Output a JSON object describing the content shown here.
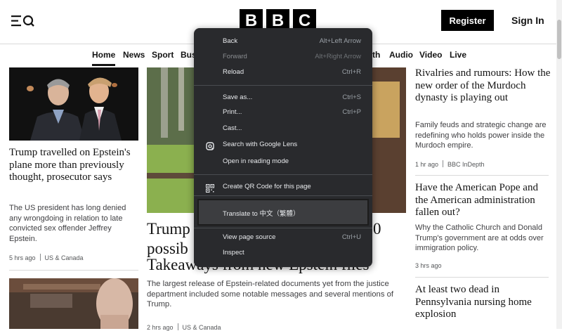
{
  "header": {
    "logo_letters": [
      "B",
      "B",
      "C"
    ],
    "register_label": "Register",
    "signin_label": "Sign In"
  },
  "nav": {
    "items": [
      {
        "label": "Home",
        "active": true
      },
      {
        "label": "News"
      },
      {
        "label": "Sport"
      },
      {
        "label": "Bus"
      },
      {
        "label": "th"
      },
      {
        "label": "Audio"
      },
      {
        "label": "Video"
      },
      {
        "label": "Live"
      }
    ]
  },
  "articles": {
    "left_top": {
      "headline": "Trump travelled on Epstein's plane more than previously thought, prosecutor says",
      "summary": "The US president has long denied any wrongdoing in relation to late convicted sex offender Jeffrey Epstein.",
      "time": "5 hrs ago",
      "section": "US & Canada"
    },
    "center": {
      "headline_visible": [
        "Trump",
        "possib",
        "Takeaways from new Epstein files"
      ],
      "headline_right_fragment": "0",
      "summary": "The largest release of Epstein-related documents yet from the justice department included some notable messages and several mentions of Trump.",
      "time": "2 hrs ago",
      "section": "US & Canada"
    },
    "right_1": {
      "headline": "Rivalries and rumours: How the new order of the Murdoch dynasty is playing out",
      "summary": "Family feuds and strategic change are redefining who holds power inside the Murdoch empire.",
      "time": "1 hr ago",
      "section": "BBC InDepth"
    },
    "right_2": {
      "headline": "Have the American Pope and the American administration fallen out?",
      "summary": "Why the Catholic Church and Donald Trump's government are at odds over immigration policy.",
      "time": "3 hrs ago"
    },
    "right_3": {
      "headline": "At least two dead in Pennsylvania nursing home explosion"
    }
  },
  "context_menu": {
    "items": [
      {
        "label": "Back",
        "shortcut": "Alt+Left Arrow"
      },
      {
        "label": "Forward",
        "shortcut": "Alt+Right Arrow",
        "disabled": true
      },
      {
        "label": "Reload",
        "shortcut": "Ctrl+R"
      },
      {
        "label": "Save as...",
        "shortcut": "Ctrl+S"
      },
      {
        "label": "Print...",
        "shortcut": "Ctrl+P"
      },
      {
        "label": "Cast..."
      },
      {
        "label": "Search with Google Lens",
        "icon": "google-lens-icon"
      },
      {
        "label": "Open in reading mode"
      },
      {
        "label": "Create QR Code for this page",
        "icon": "qr-code-icon"
      },
      {
        "label": "Translate to 中文（繁體）"
      },
      {
        "label": "View page source",
        "shortcut": "Ctrl+U"
      },
      {
        "label": "Inspect"
      }
    ]
  }
}
